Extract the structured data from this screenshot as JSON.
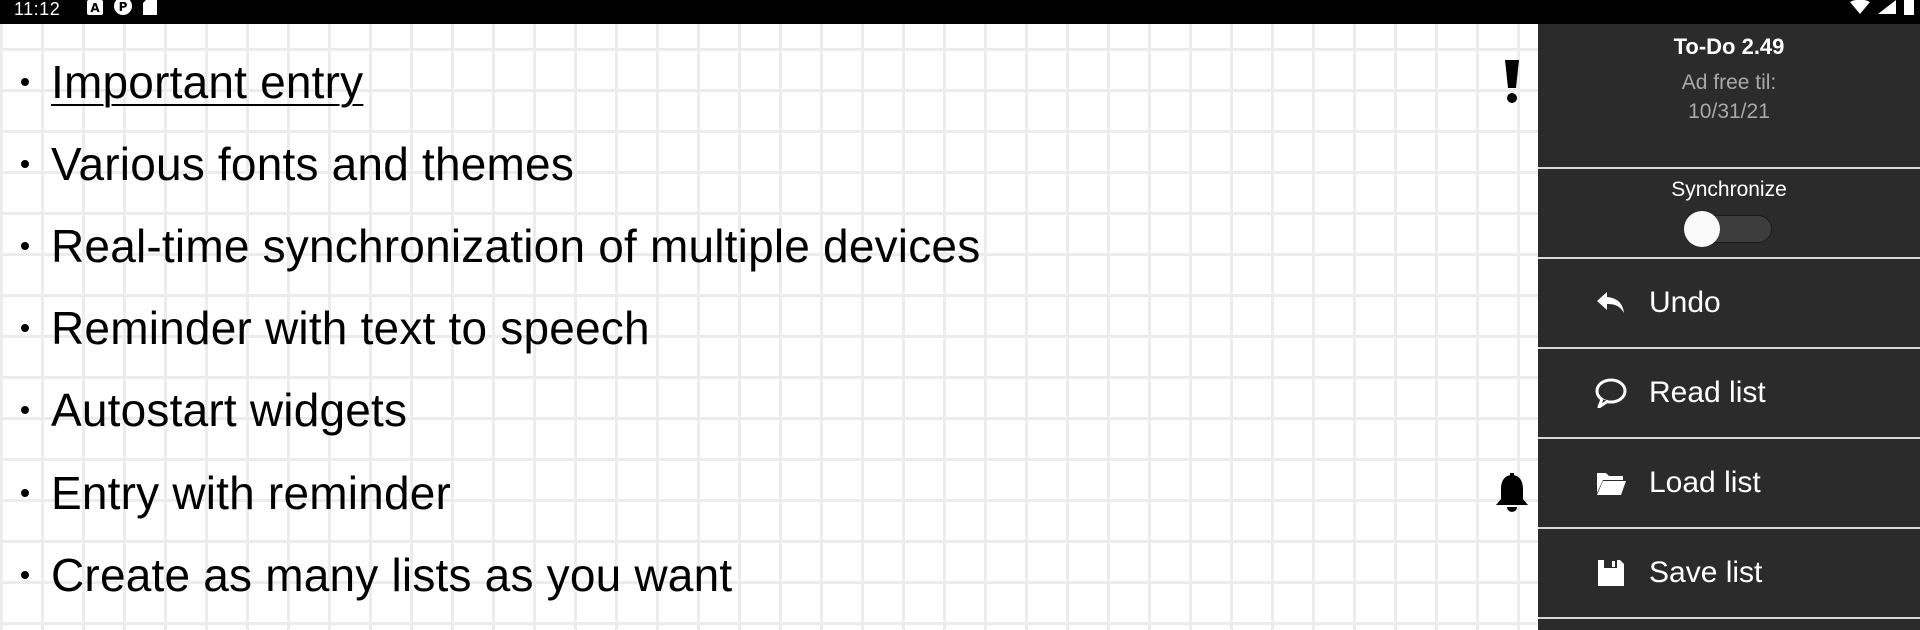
{
  "status_bar": {
    "time": "11:12",
    "left_icons": [
      "a-icon",
      "p-icon",
      "sd-card-icon"
    ],
    "right_icons": [
      "wifi-icon",
      "signal-icon",
      "battery-icon"
    ]
  },
  "list": {
    "entries": [
      {
        "text": "Important entry",
        "underlined": true,
        "trailing_icon": "exclamation-icon"
      },
      {
        "text": "Various fonts and themes",
        "underlined": false,
        "trailing_icon": ""
      },
      {
        "text": "Real-time synchronization of multiple devices",
        "underlined": false,
        "trailing_icon": ""
      },
      {
        "text": "Reminder with text to speech",
        "underlined": false,
        "trailing_icon": ""
      },
      {
        "text": "Autostart widgets",
        "underlined": false,
        "trailing_icon": ""
      },
      {
        "text": "Entry with reminder",
        "underlined": false,
        "trailing_icon": "bell-icon"
      },
      {
        "text": "Create as many lists as you want",
        "underlined": false,
        "trailing_icon": ""
      }
    ]
  },
  "drawer": {
    "app_title": "To-Do 2.49",
    "ad_free_label": "Ad free til:",
    "ad_free_date": "10/31/21",
    "sync_label": "Synchronize",
    "sync_enabled": false,
    "menu": [
      {
        "label": "Undo",
        "icon": "undo-icon"
      },
      {
        "label": "Read list",
        "icon": "speech-bubble-icon"
      },
      {
        "label": "Load list",
        "icon": "folder-open-icon"
      },
      {
        "label": "Save list",
        "icon": "save-icon"
      }
    ]
  },
  "colors": {
    "drawer_bg": "#2b2b2b",
    "grid_line": "#ececec",
    "paper": "#ffffff"
  }
}
